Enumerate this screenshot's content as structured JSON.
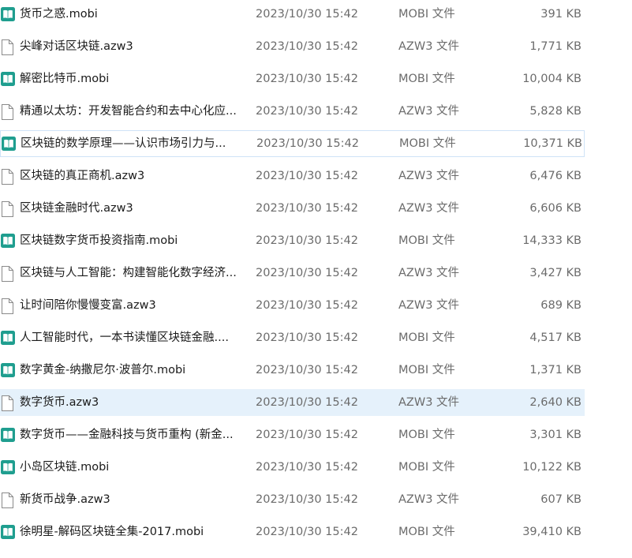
{
  "files": [
    {
      "name": "货币之惑.mobi",
      "date": "2023/10/30 15:42",
      "type": "MOBI 文件",
      "size": "391 KB",
      "icon": "mobi-book-icon"
    },
    {
      "name": "尖峰对话区块链.azw3",
      "date": "2023/10/30 15:42",
      "type": "AZW3 文件",
      "size": "1,771 KB",
      "icon": "blank-file-icon"
    },
    {
      "name": "解密比特币.mobi",
      "date": "2023/10/30 15:42",
      "type": "MOBI 文件",
      "size": "10,004 KB",
      "icon": "mobi-book-icon"
    },
    {
      "name": "精通以太坊：开发智能合约和去中心化应...",
      "date": "2023/10/30 15:42",
      "type": "AZW3 文件",
      "size": "5,828 KB",
      "icon": "blank-file-icon"
    },
    {
      "name": "区块链的数学原理——认识市场引力与...",
      "date": "2023/10/30 15:42",
      "type": "MOBI 文件",
      "size": "10,371 KB",
      "icon": "mobi-book-icon",
      "state": "hover"
    },
    {
      "name": "区块链的真正商机.azw3",
      "date": "2023/10/30 15:42",
      "type": "AZW3 文件",
      "size": "6,476 KB",
      "icon": "blank-file-icon"
    },
    {
      "name": "区块链金融时代.azw3",
      "date": "2023/10/30 15:42",
      "type": "AZW3 文件",
      "size": "6,606 KB",
      "icon": "blank-file-icon"
    },
    {
      "name": "区块链数字货币投资指南.mobi",
      "date": "2023/10/30 15:42",
      "type": "MOBI 文件",
      "size": "14,333 KB",
      "icon": "mobi-book-icon"
    },
    {
      "name": "区块链与人工智能：构建智能化数字经济...",
      "date": "2023/10/30 15:42",
      "type": "AZW3 文件",
      "size": "3,427 KB",
      "icon": "blank-file-icon"
    },
    {
      "name": "让时间陪你慢慢变富.azw3",
      "date": "2023/10/30 15:42",
      "type": "AZW3 文件",
      "size": "689 KB",
      "icon": "blank-file-icon"
    },
    {
      "name": "人工智能时代，一本书读懂区块链金融....",
      "date": "2023/10/30 15:42",
      "type": "MOBI 文件",
      "size": "4,517 KB",
      "icon": "mobi-book-icon"
    },
    {
      "name": "数字黄金-纳撒尼尔·波普尔.mobi",
      "date": "2023/10/30 15:42",
      "type": "MOBI 文件",
      "size": "1,371 KB",
      "icon": "mobi-book-icon"
    },
    {
      "name": "数字货币.azw3",
      "date": "2023/10/30 15:42",
      "type": "AZW3 文件",
      "size": "2,640 KB",
      "icon": "blank-file-icon",
      "state": "selected"
    },
    {
      "name": "数字货币——金融科技与货币重构 (新金...",
      "date": "2023/10/30 15:42",
      "type": "MOBI 文件",
      "size": "3,301 KB",
      "icon": "mobi-book-icon"
    },
    {
      "name": "小岛区块链.mobi",
      "date": "2023/10/30 15:42",
      "type": "MOBI 文件",
      "size": "10,122 KB",
      "icon": "mobi-book-icon"
    },
    {
      "name": "新货币战争.azw3",
      "date": "2023/10/30 15:42",
      "type": "AZW3 文件",
      "size": "607 KB",
      "icon": "blank-file-icon"
    },
    {
      "name": "徐明星-解码区块链全集-2017.mobi",
      "date": "2023/10/30 15:42",
      "type": "MOBI 文件",
      "size": "39,410 KB",
      "icon": "mobi-book-icon"
    }
  ],
  "colors": {
    "mobi_icon": "#1f9e8f",
    "selected_bg": "#e5f1fb",
    "hover_border": "#cfe3f7",
    "meta_text": "#6b6b6b"
  }
}
